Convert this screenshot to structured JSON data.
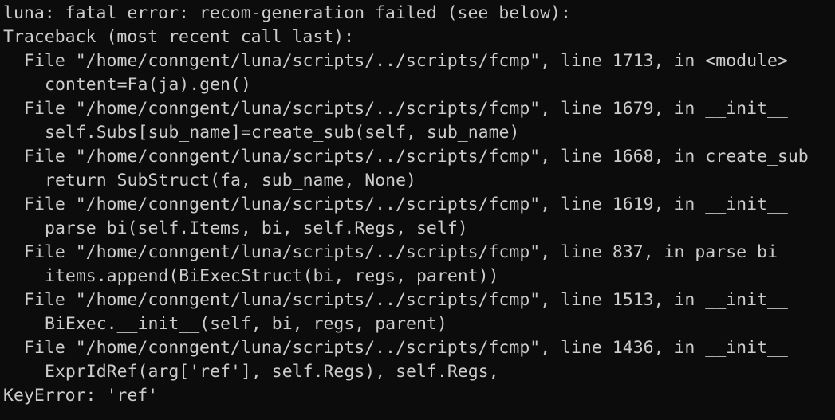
{
  "terminal": {
    "header": "luna: fatal error: recom-generation failed (see below):",
    "traceback_header": "Traceback (most recent call last):",
    "frames": [
      {
        "file_line": "File \"/home/conngent/luna/scripts/../scripts/fcmp\", line 1713, in <module>",
        "code": "content=Fa(ja).gen()"
      },
      {
        "file_line": "File \"/home/conngent/luna/scripts/../scripts/fcmp\", line 1679, in __init__",
        "code": "self.Subs[sub_name]=create_sub(self, sub_name)"
      },
      {
        "file_line": "File \"/home/conngent/luna/scripts/../scripts/fcmp\", line 1668, in create_sub",
        "code": "return SubStruct(fa, sub_name, None)"
      },
      {
        "file_line": "File \"/home/conngent/luna/scripts/../scripts/fcmp\", line 1619, in __init__",
        "code": "parse_bi(self.Items, bi, self.Regs, self)"
      },
      {
        "file_line": "File \"/home/conngent/luna/scripts/../scripts/fcmp\", line 837, in parse_bi",
        "code": "items.append(BiExecStruct(bi, regs, parent))"
      },
      {
        "file_line": "File \"/home/conngent/luna/scripts/../scripts/fcmp\", line 1513, in __init__",
        "code": "BiExec.__init__(self, bi, regs, parent)"
      },
      {
        "file_line": "File \"/home/conngent/luna/scripts/../scripts/fcmp\", line 1436, in __init__",
        "code": "ExprIdRef(arg['ref'], self.Regs), self.Regs,"
      }
    ],
    "error_line": "KeyError: 'ref'"
  }
}
